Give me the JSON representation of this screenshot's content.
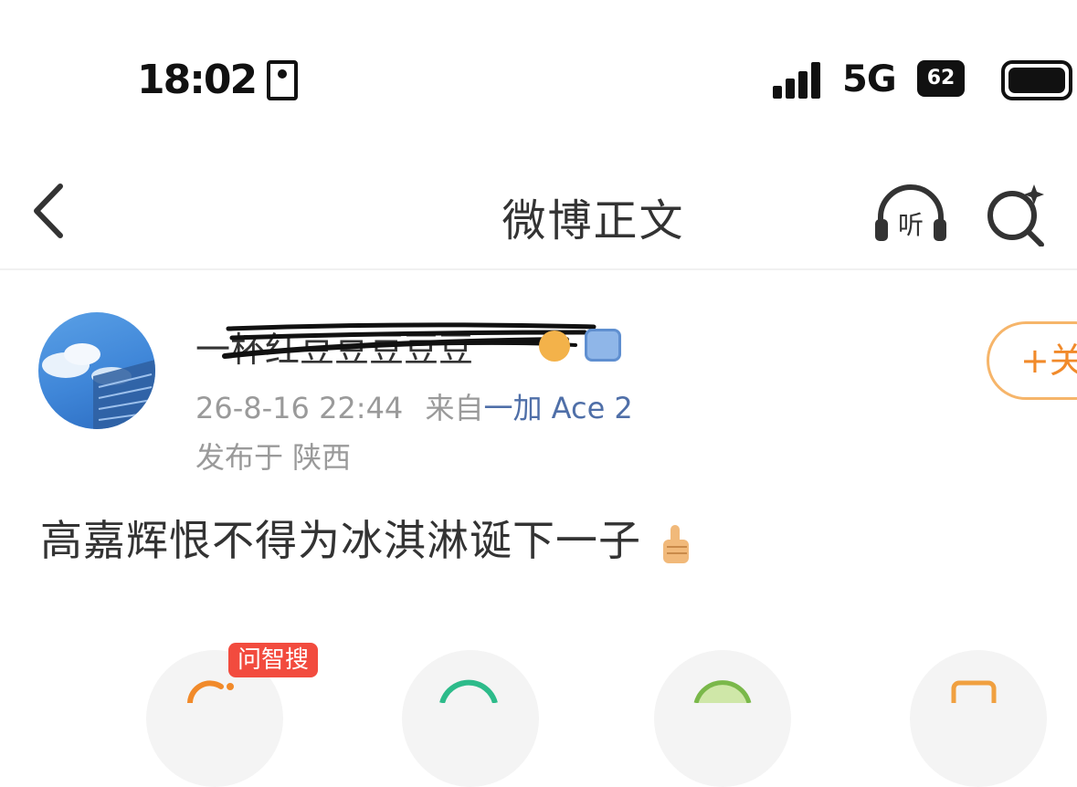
{
  "status_bar": {
    "time": "18:02",
    "network": "5G",
    "battery_text": "62"
  },
  "nav": {
    "title": "微博正文",
    "listen_label": "听"
  },
  "post": {
    "author_name": "一杯红豆豆豆豆豆",
    "date": "26-8-16 22:44",
    "source_prefix": "来自",
    "source_device": "一加 Ace 2",
    "location": "发布于 陕西",
    "body": "高嘉辉恨不得为冰淇淋诞下一子",
    "follow_label": "+关注"
  },
  "actions": {
    "ai_badge": "问智搜"
  },
  "colors": {
    "accent_orange": "#f18a2a",
    "link_blue": "#4f6fa8",
    "badge_red": "#f24b3e"
  }
}
